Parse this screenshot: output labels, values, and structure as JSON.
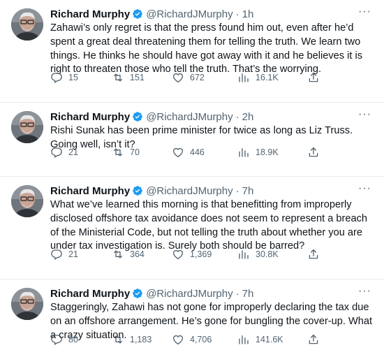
{
  "tweets": [
    {
      "author": "Richard Murphy",
      "handle": "@RichardJMurphy",
      "separator": "·",
      "time": "1h",
      "more": "···",
      "text": "Zahawi’s only regret is that the press found him out, even after he’d spent a great deal threatening them for telling the truth. We learn two things. He thinks he should have got away with it and he believes it is right to threaten those who tell the truth. That’s the worrying.",
      "replies": "15",
      "retweets": "151",
      "likes": "672",
      "views": "16.1K"
    },
    {
      "author": "Richard Murphy",
      "handle": "@RichardJMurphy",
      "separator": "·",
      "time": "2h",
      "more": "···",
      "text": "Rishi Sunak has been prime minister for twice as long as Liz Truss. Going well, isn’t it?",
      "replies": "21",
      "retweets": "70",
      "likes": "446",
      "views": "18.9K"
    },
    {
      "author": "Richard Murphy",
      "handle": "@RichardJMurphy",
      "separator": "·",
      "time": "7h",
      "more": "···",
      "text": "What we’ve learned this morning is that benefitting from improperly disclosed offshore tax avoidance does not seem to represent a breach of the Ministerial Code, but not telling  the truth about whether you are under tax investigation is. Surely both should be barred?",
      "replies": "21",
      "retweets": "364",
      "likes": "1,369",
      "views": "30.8K"
    },
    {
      "author": "Richard Murphy",
      "handle": "@RichardJMurphy",
      "separator": "·",
      "time": "7h",
      "more": "···",
      "text": "Staggeringly, Zahawi has not gone for improperly declaring the tax due on an offshore arrangement. He’s gone for bungling the cover-up. What a crazy situation.",
      "replies": "80",
      "retweets": "1,183",
      "likes": "4,706",
      "views": "141.6K"
    }
  ],
  "icons": {
    "verified": "verified-badge-icon",
    "reply": "reply-icon",
    "retweet": "retweet-icon",
    "like": "heart-icon",
    "views": "views-icon",
    "share": "share-icon",
    "more": "more-icon"
  },
  "colors": {
    "verified": "#1d9bf0",
    "text": "#0f1419",
    "secondary": "#536471",
    "divider": "#e6ecf0"
  }
}
